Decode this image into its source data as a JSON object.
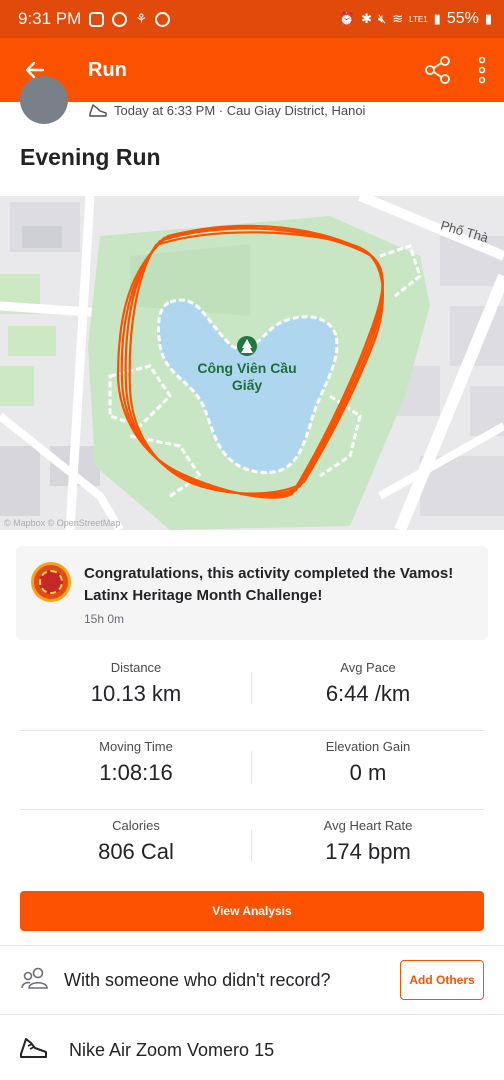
{
  "status_bar": {
    "time": "9:31 PM",
    "battery": "55%",
    "network": "LTE1"
  },
  "app_bar": {
    "title": "Run",
    "back_icon": "back-arrow-icon",
    "share_icon": "share-icon",
    "more_icon": "more-vertical-icon"
  },
  "activity": {
    "meta": "Today at 6:33 PM · Cau Giay District, Hanoi",
    "title": "Evening Run"
  },
  "map": {
    "park_name": "Công Viên Cầu Giấy",
    "street": "Phố Thà",
    "attribution": "© Mapbox © OpenStreetMap",
    "route_color": "#fc5200"
  },
  "challenge": {
    "text": "Congratulations, this activity completed the Vamos! Latinx Heritage Month Challenge!",
    "time": "15h 0m"
  },
  "stats": [
    {
      "left_label": "Distance",
      "left_value": "10.13 km",
      "right_label": "Avg Pace",
      "right_value": "6:44 /km"
    },
    {
      "left_label": "Moving Time",
      "left_value": "1:08:16",
      "right_label": "Elevation Gain",
      "right_value": "0 m"
    },
    {
      "left_label": "Calories",
      "left_value": "806 Cal",
      "right_label": "Avg Heart Rate",
      "right_value": "174 bpm"
    }
  ],
  "actions": {
    "view_analysis": "View Analysis",
    "with_someone": "With someone who didn't record?",
    "add_others": "Add Others",
    "gear": "Nike Air Zoom Vomero 15"
  },
  "colors": {
    "brand": "#fc5200",
    "status_bar": "#e24a0c"
  }
}
